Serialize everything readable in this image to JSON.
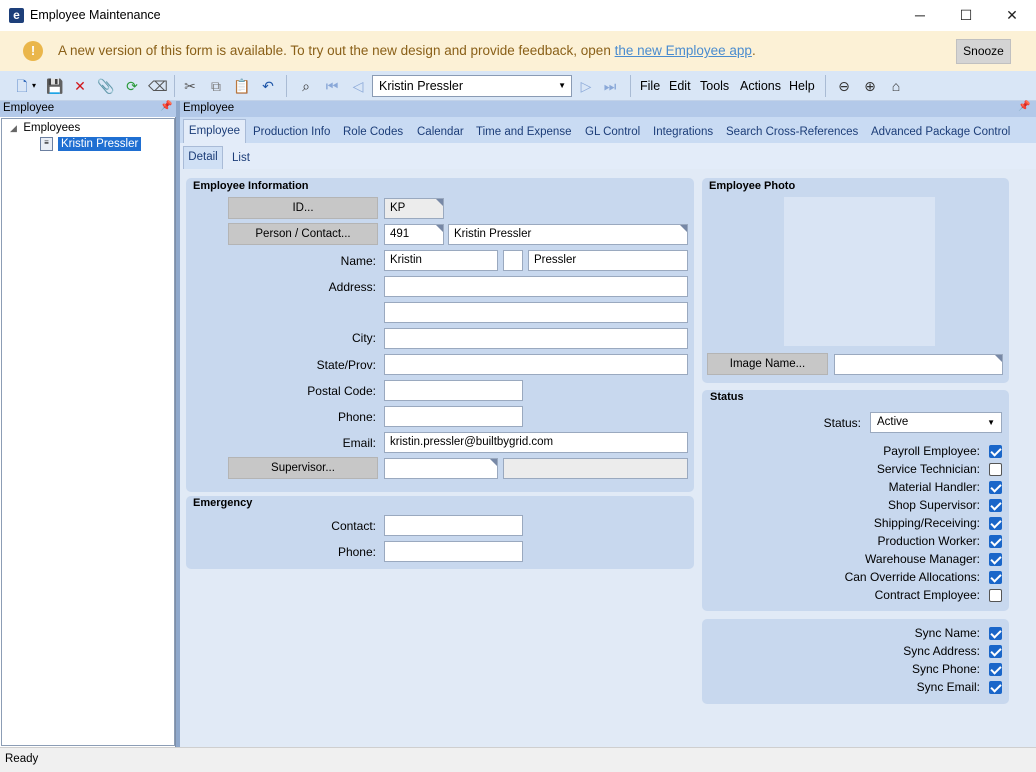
{
  "window": {
    "title": "Employee Maintenance",
    "minimize": "─",
    "maximize": "☐",
    "close": "✕"
  },
  "banner": {
    "message": "A new version of this form is available. To try out the new design and provide feedback, open ",
    "link": "the new Employee app",
    "suffix": ".",
    "snooze": "Snooze"
  },
  "toolbar": {
    "selected_employee": "Kristin Pressler",
    "menus": [
      "File",
      "Edit",
      "Tools",
      "Actions",
      "Help"
    ]
  },
  "left_panel": {
    "header": "Employee",
    "tree_root": "Employees",
    "tree_leaf": "Kristin Pressler"
  },
  "right_panel": {
    "header": "Employee",
    "tabs": [
      "Employee",
      "Production Info",
      "Role Codes",
      "Calendar",
      "Time and Expense",
      "GL Control",
      "Integrations",
      "Search Cross-References",
      "Advanced Package Control"
    ],
    "subtabs": [
      "Detail",
      "List"
    ]
  },
  "employee_info": {
    "title": "Employee Information",
    "id_button": "ID...",
    "id_value": "KP",
    "person_button": "Person / Contact...",
    "person_id": "491",
    "person_name": "Kristin Pressler",
    "name_label": "Name:",
    "first_name": "Kristin",
    "middle_name": "",
    "last_name": "Pressler",
    "address_label": "Address:",
    "address1": "",
    "address2": "",
    "city_label": "City:",
    "city": "",
    "state_label": "State/Prov:",
    "state": "",
    "postal_label": "Postal Code:",
    "postal": "",
    "phone_label": "Phone:",
    "phone": "",
    "email_label": "Email:",
    "email": "kristin.pressler@builtbygrid.com",
    "supervisor_button": "Supervisor...",
    "supervisor_id": "",
    "supervisor_name": ""
  },
  "emergency": {
    "title": "Emergency",
    "contact_label": "Contact:",
    "contact": "",
    "phone_label": "Phone:",
    "phone": ""
  },
  "photo": {
    "title": "Employee Photo",
    "image_button": "Image Name...",
    "image_name": ""
  },
  "status": {
    "title": "Status",
    "status_label": "Status:",
    "status_value": "Active",
    "checks": [
      {
        "label": "Payroll Employee:",
        "checked": true
      },
      {
        "label": "Service Technician:",
        "checked": false
      },
      {
        "label": "Material Handler:",
        "checked": true
      },
      {
        "label": "Shop Supervisor:",
        "checked": true
      },
      {
        "label": "Shipping/Receiving:",
        "checked": true
      },
      {
        "label": "Production Worker:",
        "checked": true
      },
      {
        "label": "Warehouse Manager:",
        "checked": true
      },
      {
        "label": "Can Override Allocations:",
        "checked": true
      },
      {
        "label": "Contract Employee:",
        "checked": false
      }
    ]
  },
  "sync": {
    "checks": [
      {
        "label": "Sync Name:",
        "checked": true
      },
      {
        "label": "Sync Address:",
        "checked": true
      },
      {
        "label": "Sync Phone:",
        "checked": true
      },
      {
        "label": "Sync Email:",
        "checked": true
      }
    ]
  },
  "statusbar": {
    "text": "Ready"
  },
  "colors": {
    "accent": "#1a66c9",
    "banner_bg": "#fcf1d6",
    "panel_bg": "#c8d8ee"
  }
}
